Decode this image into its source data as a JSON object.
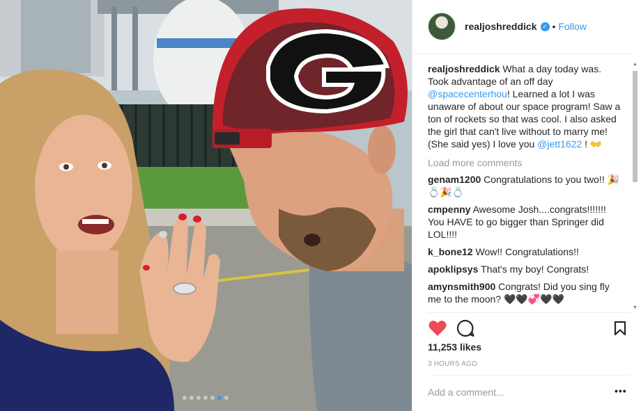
{
  "post": {
    "photo": {
      "carousel_dot_count": 7,
      "carousel_active_index": 5
    },
    "header": {
      "username": "realjoshreddick",
      "verified_glyph": "✓",
      "separator": "•",
      "follow_label": "Follow"
    },
    "caption": {
      "username": "realjoshreddick",
      "text_1": "What a day today was. Took advantage of an off day ",
      "mention_1": "@spacecenterhou",
      "text_2": "! Learned a lot I was unaware of about our space program! Saw a ton of rockets so that was cool. I also asked the girl that can't live without to marry me! (She said yes) I love you ",
      "mention_2": "@jett1622",
      "text_3": " ! 👐"
    },
    "load_more_label": "Load more comments",
    "comments": [
      {
        "username": "genam1200",
        "text": "Congratulations to you two!! 🎉💍🎉💍"
      },
      {
        "username": "cmpenny",
        "text": "Awesome Josh....congrats!!!!!!! You HAVE to go bigger than Springer did LOL!!!!"
      },
      {
        "username": "k_bone12",
        "text": "Wow!! Congratulations!!"
      },
      {
        "username": "apoklipsys",
        "text": "That's my boy! Congrats!"
      },
      {
        "username": "amynsmith900",
        "text": "Congrats! Did you sing fly me to the moon? 🖤🖤💞🖤🖤"
      }
    ],
    "likes_label": "11,253 likes",
    "time_label": "3 HOURS AGO",
    "add_comment_placeholder": "Add a comment...",
    "more_options_label": "•••",
    "icons": {
      "like": "heart-icon",
      "comment": "speech-bubble-icon",
      "save": "bookmark-icon",
      "verified": "verified-badge-icon"
    },
    "colors": {
      "like_red": "#ed4956",
      "link_blue": "#3897f0",
      "text_dark": "#262626",
      "muted_gray": "#999999"
    }
  }
}
